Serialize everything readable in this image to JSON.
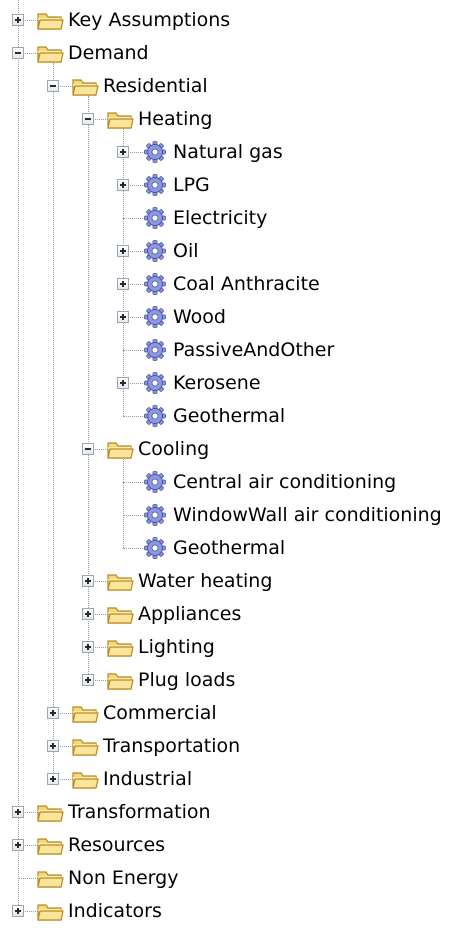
{
  "tree": {
    "nodes": [
      {
        "label": "Key Assumptions",
        "level": 0,
        "type": "folder",
        "expander": "plus"
      },
      {
        "label": "Demand",
        "level": 0,
        "type": "folder",
        "expander": "minus"
      },
      {
        "label": "Residential",
        "level": 1,
        "type": "folder",
        "expander": "minus"
      },
      {
        "label": "Heating",
        "level": 2,
        "type": "folder",
        "expander": "minus"
      },
      {
        "label": "Natural gas",
        "level": 3,
        "type": "gear",
        "expander": "plus"
      },
      {
        "label": "LPG",
        "level": 3,
        "type": "gear",
        "expander": "plus"
      },
      {
        "label": "Electricity",
        "level": 3,
        "type": "gear",
        "expander": "none"
      },
      {
        "label": "Oil",
        "level": 3,
        "type": "gear",
        "expander": "plus"
      },
      {
        "label": "Coal Anthracite",
        "level": 3,
        "type": "gear",
        "expander": "plus"
      },
      {
        "label": "Wood",
        "level": 3,
        "type": "gear",
        "expander": "plus"
      },
      {
        "label": "PassiveAndOther",
        "level": 3,
        "type": "gear",
        "expander": "none"
      },
      {
        "label": "Kerosene",
        "level": 3,
        "type": "gear",
        "expander": "plus"
      },
      {
        "label": "Geothermal",
        "level": 3,
        "type": "gear",
        "expander": "none"
      },
      {
        "label": "Cooling",
        "level": 2,
        "type": "folder",
        "expander": "minus"
      },
      {
        "label": "Central air conditioning",
        "level": 3,
        "type": "gear",
        "expander": "none"
      },
      {
        "label": "WindowWall air conditioning",
        "level": 3,
        "type": "gear",
        "expander": "none"
      },
      {
        "label": "Geothermal",
        "level": 3,
        "type": "gear",
        "expander": "none"
      },
      {
        "label": "Water heating",
        "level": 2,
        "type": "folder",
        "expander": "plus"
      },
      {
        "label": "Appliances",
        "level": 2,
        "type": "folder",
        "expander": "plus"
      },
      {
        "label": "Lighting",
        "level": 2,
        "type": "folder",
        "expander": "plus"
      },
      {
        "label": "Plug loads",
        "level": 2,
        "type": "folder",
        "expander": "plus"
      },
      {
        "label": "Commercial",
        "level": 1,
        "type": "folder",
        "expander": "plus"
      },
      {
        "label": "Transportation",
        "level": 1,
        "type": "folder",
        "expander": "plus"
      },
      {
        "label": "Industrial",
        "level": 1,
        "type": "folder",
        "expander": "plus"
      },
      {
        "label": "Transformation",
        "level": 0,
        "type": "folder",
        "expander": "plus"
      },
      {
        "label": "Resources",
        "level": 0,
        "type": "folder",
        "expander": "plus"
      },
      {
        "label": "Non Energy",
        "level": 0,
        "type": "folder",
        "expander": "none"
      },
      {
        "label": "Indicators",
        "level": 0,
        "type": "folder",
        "expander": "plus"
      }
    ]
  },
  "colors": {
    "folder_fill": "#f6d77a",
    "folder_stroke": "#b78a1c",
    "gear_fill": "#8d97e0",
    "gear_stroke": "#4b56a8",
    "connector": "#9a9a9a"
  }
}
